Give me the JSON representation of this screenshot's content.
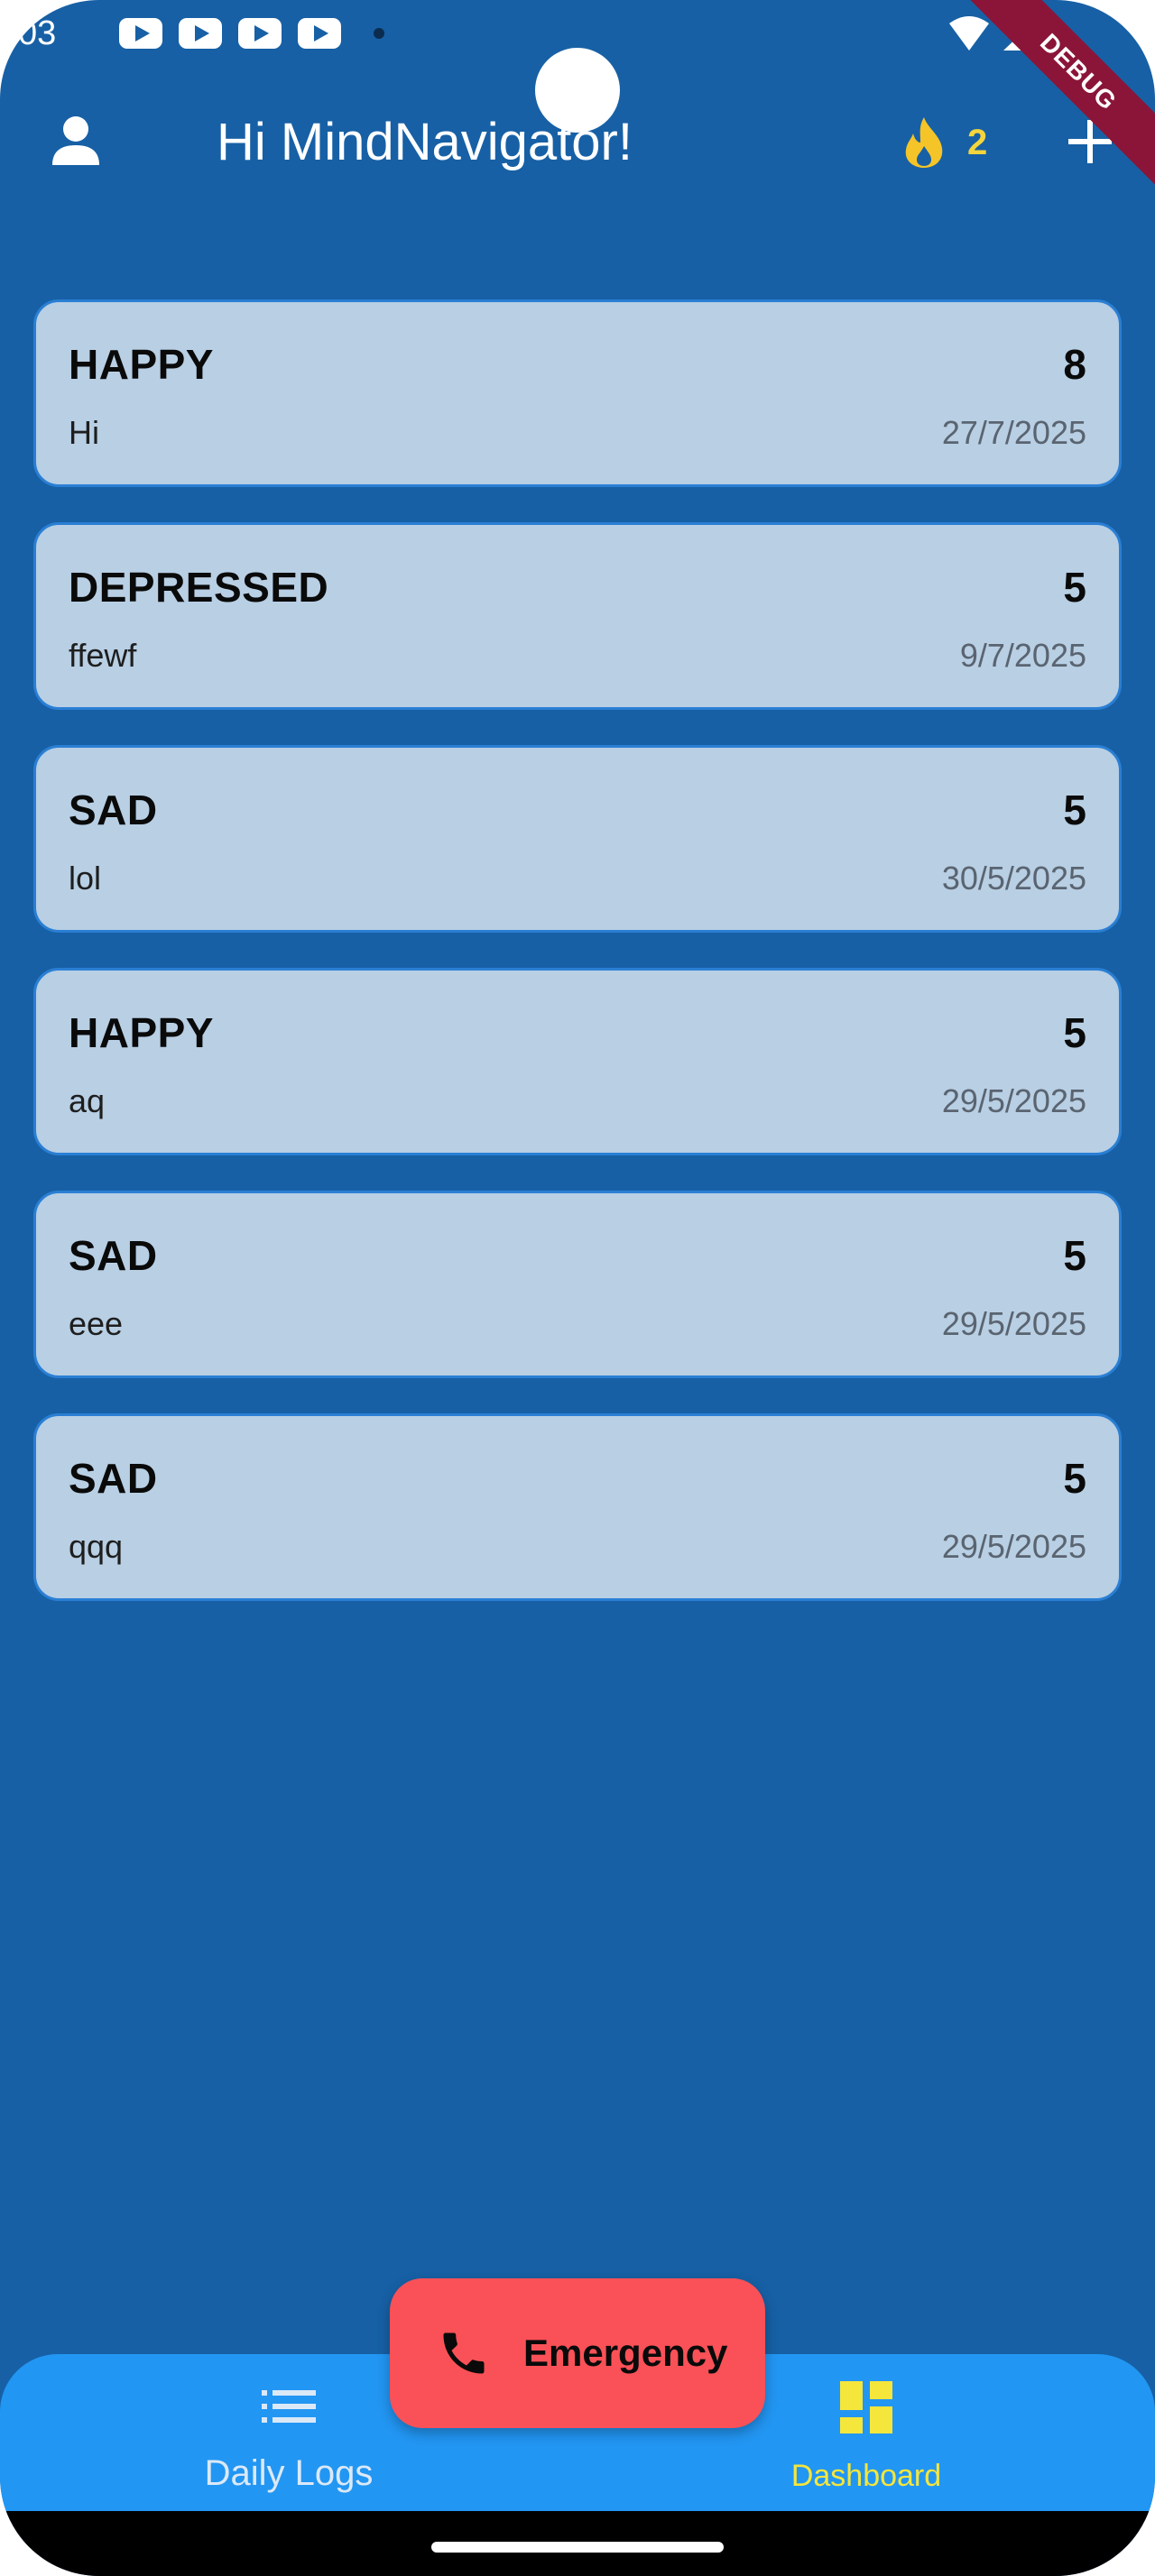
{
  "status_bar": {
    "time": "03",
    "notification_icons": [
      "youtube-icon",
      "youtube-icon",
      "youtube-icon",
      "youtube-icon"
    ],
    "right_icons": [
      "wifi-icon",
      "signal-icon"
    ]
  },
  "debug_banner": "DEBUG",
  "app_bar": {
    "title": "Hi MindNavigator!",
    "streak_count": "2",
    "icons": {
      "profile": "person-icon",
      "streak": "fire-icon",
      "add": "plus-icon"
    }
  },
  "logs": [
    {
      "mood": "HAPPY",
      "score": "8",
      "note": "Hi",
      "date": "27/7/2025"
    },
    {
      "mood": "DEPRESSED",
      "score": "5",
      "note": "ffewf",
      "date": "9/7/2025"
    },
    {
      "mood": "SAD",
      "score": "5",
      "note": "lol",
      "date": "30/5/2025"
    },
    {
      "mood": "HAPPY",
      "score": "5",
      "note": "aq",
      "date": "29/5/2025"
    },
    {
      "mood": "SAD",
      "score": "5",
      "note": "eee",
      "date": "29/5/2025"
    },
    {
      "mood": "SAD",
      "score": "5",
      "note": "qqq",
      "date": "29/5/2025"
    }
  ],
  "emergency_button": {
    "label": "Emergency",
    "icon": "phone-icon"
  },
  "bottom_nav": {
    "items": [
      {
        "label": "Daily Logs",
        "icon": "list-icon",
        "active": false
      },
      {
        "label": "Dashboard",
        "icon": "dashboard-icon",
        "active": true
      }
    ]
  },
  "colors": {
    "background": "#1760a5",
    "card": "#b8cfe4",
    "card_border": "#2a7fd4",
    "nav_bar": "#2296f3",
    "accent_yellow": "#f5e63c",
    "emergency": "#f95157"
  }
}
